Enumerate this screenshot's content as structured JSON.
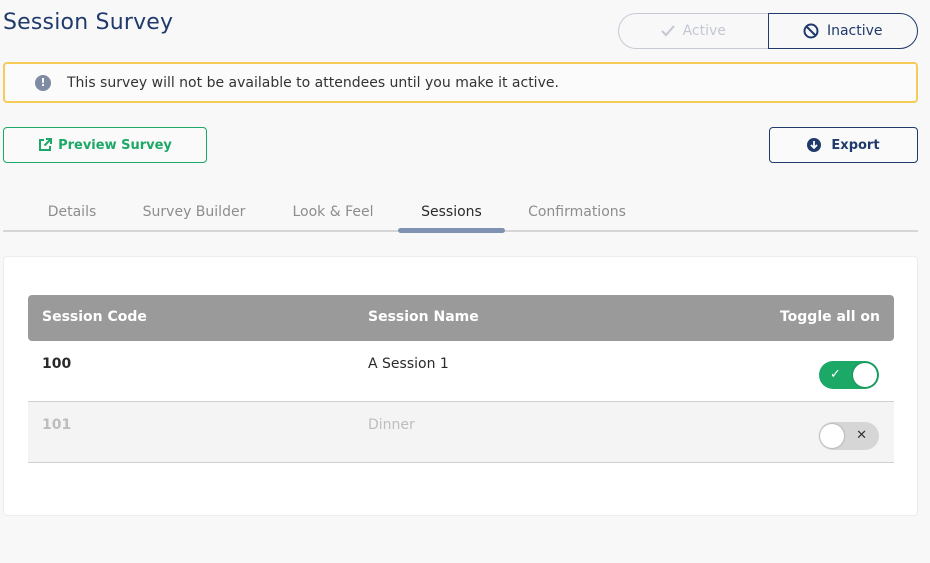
{
  "header": {
    "title": "Session Survey"
  },
  "status": {
    "active_label": "Active",
    "inactive_label": "Inactive",
    "selected": "Inactive"
  },
  "alert": {
    "message": "This survey will not be available to attendees until you make it active.",
    "icon": "info-icon"
  },
  "actions": {
    "preview_label": "Preview Survey",
    "export_label": "Export"
  },
  "tabs": [
    {
      "label": "Details"
    },
    {
      "label": "Survey Builder"
    },
    {
      "label": "Look & Feel"
    },
    {
      "label": "Sessions"
    },
    {
      "label": "Confirmations"
    }
  ],
  "selected_tab": "Sessions",
  "table": {
    "columns": {
      "code": "Session Code",
      "name": "Session Name",
      "toggle": "Toggle all on"
    },
    "rows": [
      {
        "code": "100",
        "name": "A Session 1",
        "enabled": true
      },
      {
        "code": "101",
        "name": "Dinner",
        "enabled": false
      }
    ]
  },
  "colors": {
    "brand_navy": "#1f3a6b",
    "success_green": "#1ca867",
    "warning_yellow": "#f5cc5a",
    "header_gray": "#9a9a9a"
  }
}
